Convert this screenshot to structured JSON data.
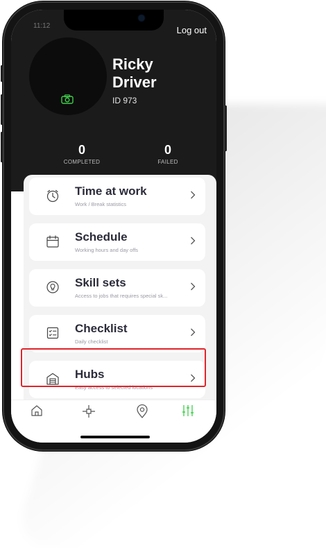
{
  "status": {
    "time": "11:12"
  },
  "header": {
    "logout_label": "Log out"
  },
  "profile": {
    "first_name": "Ricky",
    "last_name": "Driver",
    "id_label": "ID 973"
  },
  "stats": [
    {
      "value": "0",
      "label": "COMPLETED"
    },
    {
      "value": "0",
      "label": "FAILED"
    }
  ],
  "menu": [
    {
      "title": "Time at work",
      "subtitle": "Work / Break statistics",
      "icon": "clock-icon"
    },
    {
      "title": "Schedule",
      "subtitle": "Working hours and day offs",
      "icon": "calendar-icon"
    },
    {
      "title": "Skill sets",
      "subtitle": "Access to jobs that requires special sk...",
      "icon": "lightbulb-icon"
    },
    {
      "title": "Checklist",
      "subtitle": "Daily checklist",
      "icon": "checklist-icon"
    },
    {
      "title": "Hubs",
      "subtitle": "Easy access to selected locations",
      "icon": "warehouse-icon"
    }
  ],
  "tabs": [
    {
      "icon": "home-icon",
      "active": false
    },
    {
      "icon": "crosshair-icon",
      "active": false
    },
    {
      "icon": "location-pin-icon",
      "active": false
    },
    {
      "icon": "settings-sliders-icon",
      "active": true
    }
  ],
  "colors": {
    "accent_green": "#3ecf4a",
    "header_bg": "#1b1b1b",
    "highlight_red": "#e0242b"
  }
}
